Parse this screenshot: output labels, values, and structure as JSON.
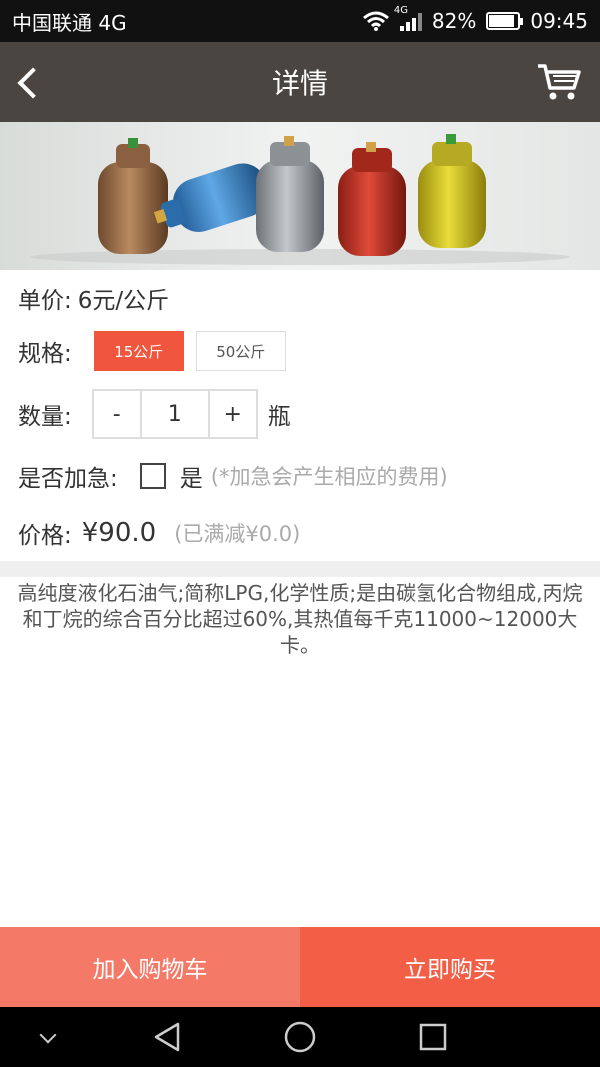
{
  "status": {
    "carrier": "中国联通 4G",
    "net": "4G",
    "battery_percent": "82%",
    "battery_level": 0.82,
    "time": "09:45"
  },
  "nav": {
    "title": "详情",
    "back_icon": "back-arrow-icon",
    "cart_icon": "shopping-cart-icon"
  },
  "product": {
    "price_label": "单价:",
    "price_value": "6元/公斤",
    "spec_label": "规格:",
    "spec_options": [
      "15公斤",
      "50公斤"
    ],
    "spec_selected": "15公斤",
    "qty_label": "数量:",
    "qty_minus": "-",
    "qty_value": "1",
    "qty_plus": "+",
    "qty_unit": "瓶",
    "urgent_label": "是否加急:",
    "urgent_option": "是",
    "urgent_note": "(*加急会产生相应的费用)",
    "total_label": "价格:",
    "total_value": "¥90.0",
    "discount_note": "(已满减¥0.0)",
    "description": "高纯度液化石油气;简称LPG,化学性质;是由碳氢化合物组成,丙烷和丁烷的综合百分比超过60%,其热值每千克11000~12000大卡。"
  },
  "actions": {
    "add_to_cart": "加入购物车",
    "buy_now": "立即购买"
  },
  "colors": {
    "nav_bg": "#4a4540",
    "accent": "#f0553d",
    "cart_btn": "#f47a67",
    "buy_btn": "#f25f46"
  }
}
